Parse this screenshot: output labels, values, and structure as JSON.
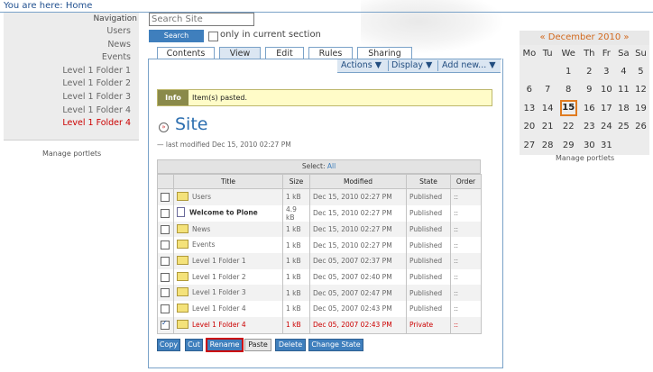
{
  "breadcrumb": {
    "prefix": "You are here:",
    "home": "Home"
  },
  "navigation": {
    "title": "Navigation",
    "items": [
      "Users",
      "News",
      "Events",
      "Level 1 Folder 1",
      "Level 1 Folder 2",
      "Level 1 Folder 3",
      "Level 1 Folder 4",
      "Level 1 Folder 4"
    ],
    "manage": "Manage portlets"
  },
  "search": {
    "placeholder": "Search Site",
    "button": "Search",
    "only_current": "only in current section"
  },
  "tabs": [
    "Contents",
    "View",
    "Edit",
    "Rules",
    "Sharing"
  ],
  "actions": [
    "Actions ▼",
    "Display ▼",
    "Add new... ▼"
  ],
  "info": {
    "label": "Info",
    "message": "Item(s) pasted."
  },
  "page": {
    "title": "Site",
    "last_modified": "— last modified Dec 15, 2010 02:27 PM"
  },
  "table": {
    "select_label": "Select:",
    "select_all": "All",
    "headers": [
      "Title",
      "Size",
      "Modified",
      "State",
      "Order"
    ],
    "rows": [
      {
        "title": "Users",
        "size": "1 kB",
        "modified": "Dec 15, 2010 02:27 PM",
        "state": "Published",
        "order": "::"
      },
      {
        "title": "Welcome to Plone",
        "size": "4.9 kB",
        "modified": "Dec 15, 2010 02:27 PM",
        "state": "Published",
        "order": "::"
      },
      {
        "title": "News",
        "size": "1 kB",
        "modified": "Dec 15, 2010 02:27 PM",
        "state": "Published",
        "order": "::"
      },
      {
        "title": "Events",
        "size": "1 kB",
        "modified": "Dec 15, 2010 02:27 PM",
        "state": "Published",
        "order": "::"
      },
      {
        "title": "Level 1 Folder 1",
        "size": "1 kB",
        "modified": "Dec 05, 2007 02:37 PM",
        "state": "Published",
        "order": "::"
      },
      {
        "title": "Level 1 Folder 2",
        "size": "1 kB",
        "modified": "Dec 05, 2007 02:40 PM",
        "state": "Published",
        "order": "::"
      },
      {
        "title": "Level 1 Folder 3",
        "size": "1 kB",
        "modified": "Dec 05, 2007 02:47 PM",
        "state": "Published",
        "order": "::"
      },
      {
        "title": "Level 1 Folder 4",
        "size": "1 kB",
        "modified": "Dec 05, 2007 02:43 PM",
        "state": "Published",
        "order": "::"
      },
      {
        "title": "Level 1 Folder 4",
        "size": "1 kB",
        "modified": "Dec 05, 2007 02:43 PM",
        "state": "Private",
        "order": "::"
      }
    ]
  },
  "buttons": [
    "Copy",
    "Cut",
    "Rename",
    "Paste",
    "Delete",
    "Change State"
  ],
  "calendar": {
    "title": "« December 2010 »",
    "days": [
      "Mo",
      "Tu",
      "We",
      "Th",
      "Fr",
      "Sa",
      "Su"
    ],
    "weeks": [
      [
        "",
        "",
        "1",
        "2",
        "3",
        "4",
        "5"
      ],
      [
        "6",
        "7",
        "8",
        "9",
        "10",
        "11",
        "12"
      ],
      [
        "13",
        "14",
        "15",
        "16",
        "17",
        "18",
        "19"
      ],
      [
        "20",
        "21",
        "22",
        "23",
        "24",
        "25",
        "26"
      ],
      [
        "27",
        "28",
        "29",
        "30",
        "31",
        "",
        ""
      ]
    ],
    "today": "15",
    "manage": "Manage portlets"
  },
  "colors": {
    "accent": "#3f7fbd",
    "current": "#cc0000",
    "today_border": "#e07b20"
  }
}
